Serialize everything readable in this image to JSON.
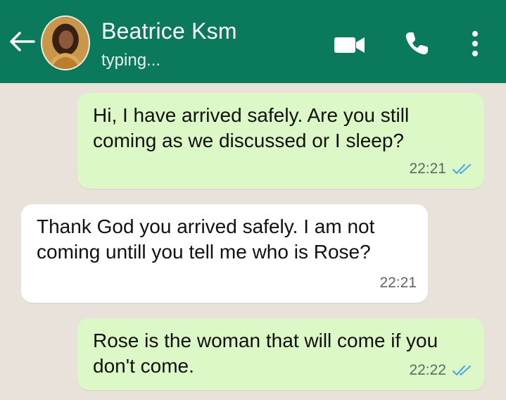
{
  "header": {
    "contact_name": "Beatrice Ksm",
    "status": "typing...",
    "back_icon": "arrow-left-icon",
    "video_icon": "video-camera-icon",
    "call_icon": "phone-icon",
    "menu_icon": "more-vertical-icon",
    "color": "#0b7a5c"
  },
  "messages": [
    {
      "direction": "outgoing",
      "text": "Hi, I have arrived safely. Are you still coming as we discussed or I sleep?",
      "time": "22:21",
      "status": "read"
    },
    {
      "direction": "incoming",
      "text": "Thank God you arrived safely. I am not coming untill you tell me who is Rose?",
      "time": "22:21"
    },
    {
      "direction": "outgoing",
      "text": "Rose is the woman that will come if you don't come.",
      "time": "22:22",
      "status": "read"
    }
  ],
  "colors": {
    "outgoing_bubble": "#dcf8c6",
    "incoming_bubble": "#ffffff",
    "read_ticks": "#4fa9e8",
    "chat_background": "#e8e2da"
  }
}
